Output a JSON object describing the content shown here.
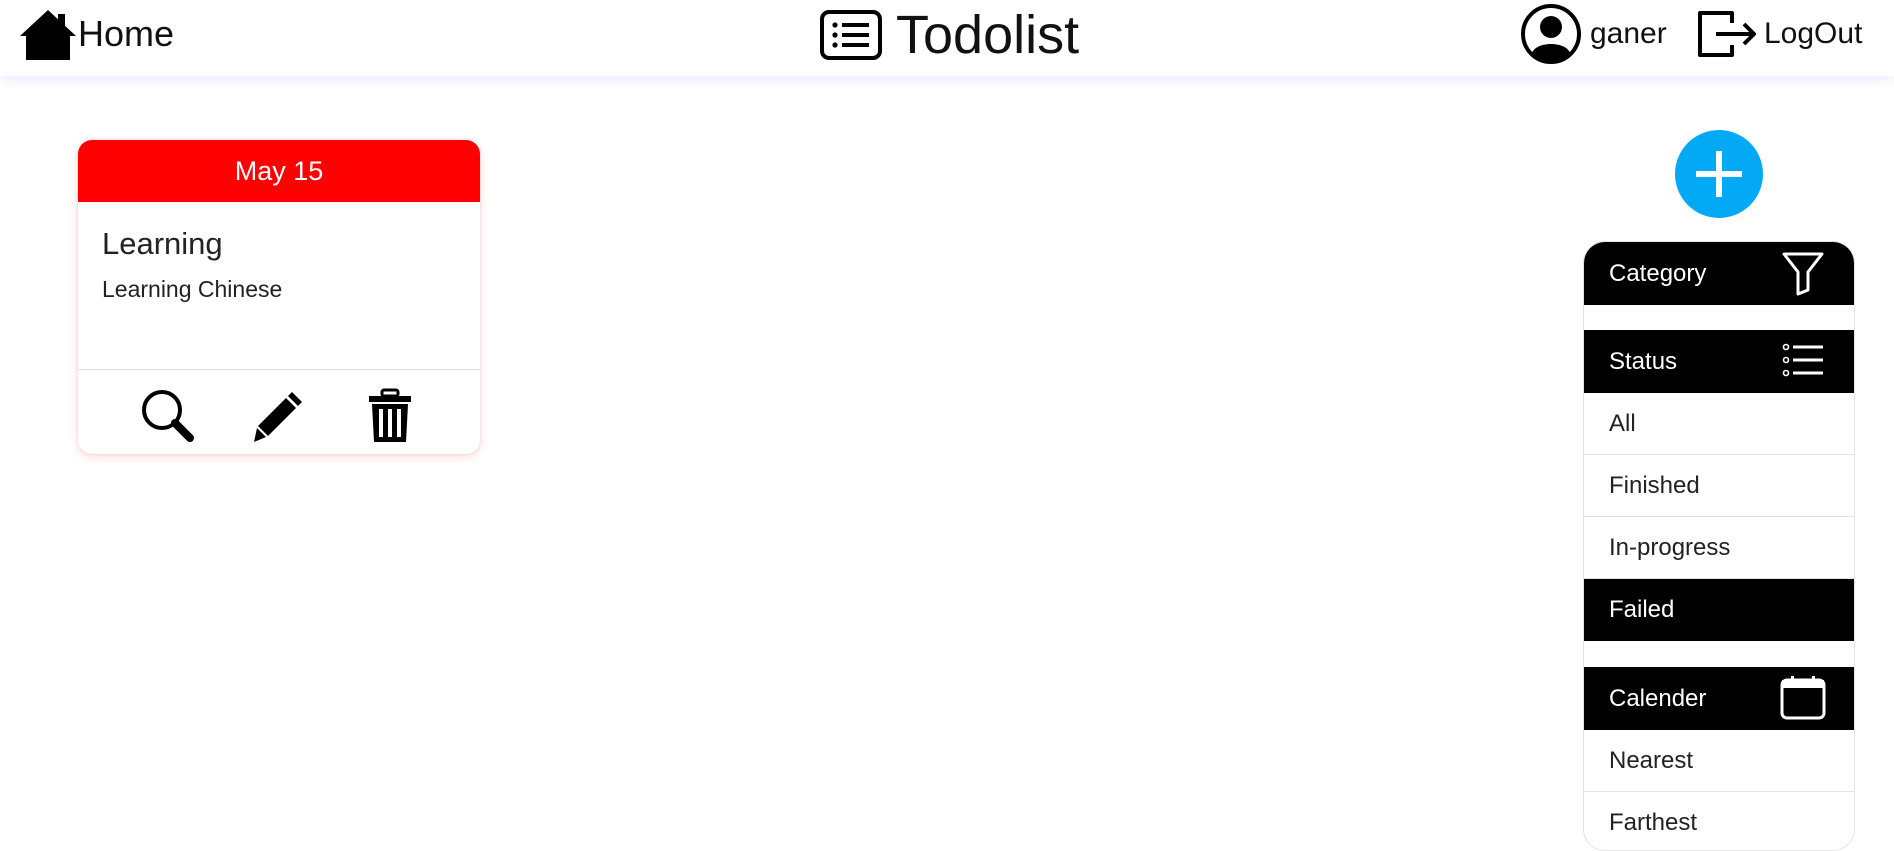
{
  "header": {
    "home_label": "Home",
    "app_title": "Todolist",
    "username": "ganer",
    "logout_label": "LogOut"
  },
  "task_card": {
    "date": "May 15",
    "header_color": "#ff0000",
    "title": "Learning",
    "description": "Learning Chinese",
    "actions": [
      "view",
      "edit",
      "delete"
    ]
  },
  "add_button": {
    "icon": "plus-icon",
    "color": "#03a9f4"
  },
  "filters": {
    "category": {
      "label": "Category",
      "icon": "filter-icon"
    },
    "status": {
      "label": "Status",
      "icon": "list-icon",
      "options": [
        "All",
        "Finished",
        "In-progress",
        "Failed"
      ],
      "selected": "Failed"
    },
    "calendar": {
      "label": "Calender",
      "icon": "calendar-icon",
      "options": [
        "Nearest",
        "Farthest"
      ]
    }
  }
}
